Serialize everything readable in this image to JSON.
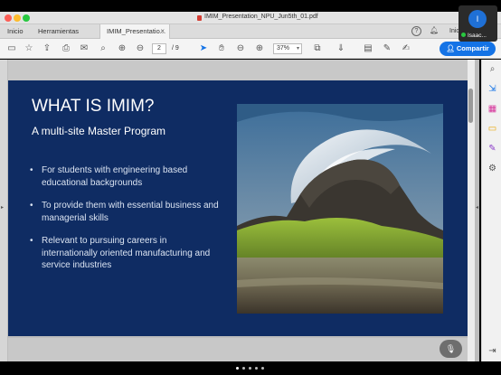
{
  "window": {
    "title": "IMIM_Presentation_NPU_Jun5th_01.pdf"
  },
  "tabs": {
    "inicio": "Inicio",
    "herramientas": "Herramientas",
    "document": "IMIM_Presentatio...",
    "close_glyph": "×",
    "user_initials_truncated": "Inic"
  },
  "toolbar": {
    "current_page": "2",
    "page_separator": "/ 9",
    "zoom": "37%",
    "share_label": "Compartir"
  },
  "video": {
    "initial": "I",
    "name": "Isaac..."
  },
  "slide": {
    "title": "WHAT IS IMIM?",
    "subtitle": "A multi-site Master Program",
    "bullets": [
      "For students with engineering based educational backgrounds",
      "To provide them with essential business and managerial skills",
      "Relevant to pursuing careers in internationally oriented manufacturing and service industries"
    ]
  },
  "colors": {
    "slide_bg": "#0f2c63",
    "share_blue": "#1473e6",
    "accent_red": "#d43d33"
  },
  "icons": {
    "toolbar": [
      "save-icon",
      "bookmark-star-icon",
      "upload-icon",
      "print-icon",
      "email-icon",
      "zoom-search-icon",
      "page-up-icon",
      "page-down-icon",
      "select-cursor-icon",
      "hand-tool-icon",
      "zoom-out-icon",
      "zoom-in-icon",
      "fit-page-icon",
      "scroll-icon",
      "comment-icon",
      "pen-icon",
      "sign-icon"
    ],
    "right_panel": [
      "search-zoom-icon",
      "export-pdf-icon",
      "edit-pdf-icon",
      "comment-icon",
      "fill-sign-icon",
      "more-tools-icon",
      "collapse-panel-icon"
    ]
  },
  "pager": {
    "count": 5,
    "active_index": 0
  }
}
